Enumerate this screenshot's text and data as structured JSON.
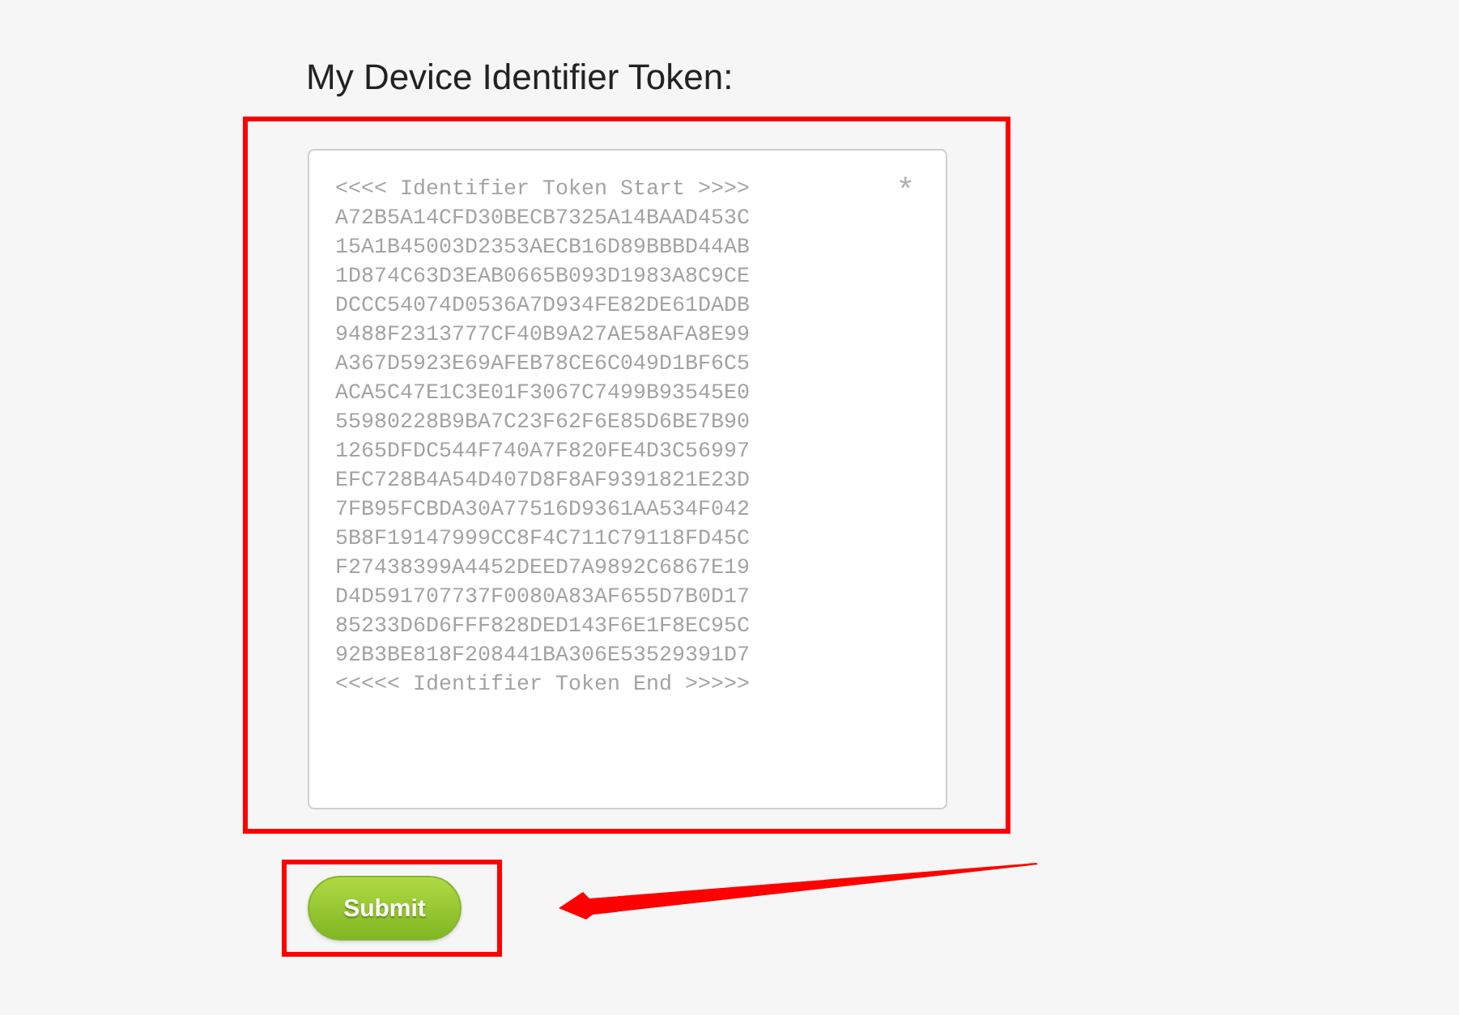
{
  "heading": "My Device Identifier Token:",
  "token_field": {
    "highlighted": true,
    "required_mark": "*",
    "value": "<<<< Identifier Token Start >>>>\nA72B5A14CFD30BECB7325A14BAAD453C\n15A1B45003D2353AECB16D89BBBD44AB\n1D874C63D3EAB0665B093D1983A8C9CE\nDCCC54074D0536A7D934FE82DE61DADB\n9488F2313777CF40B9A27AE58AFA8E99\nA367D5923E69AFEB78CE6C049D1BF6C5\nACA5C47E1C3E01F3067C7499B93545E0\n55980228B9BA7C23F62F6E85D6BE7B90\n1265DFDC544F740A7F820FE4D3C56997\nEFC728B4A54D407D8F8AF9391821E23D\n7FB95FCBDA30A77516D9361AA534F042\n5B8F19147999CC8F4C711C79118FD45C\nF27438399A4452DEED7A9892C6867E19\nD4D591707737F0080A83AF655D7B0D17\n85233D6D6FFF828DED143F6E1F8EC95C\n92B3BE818F208441BA306E53529391D7\n<<<<< Identifier Token End >>>>>"
  },
  "submit_button": {
    "label": "Submit",
    "highlighted": true,
    "arrow_pointer": true
  }
}
